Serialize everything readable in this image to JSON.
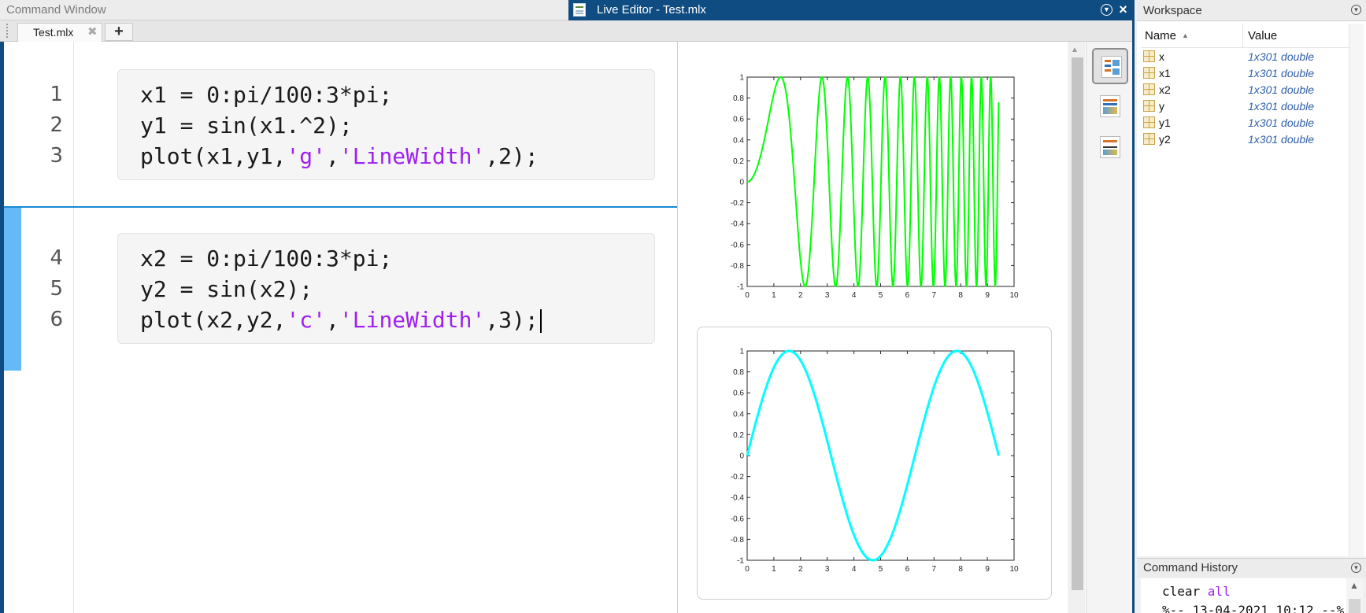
{
  "command_window": {
    "title": "Command Window"
  },
  "live_editor": {
    "title": "Live Editor - Test.mlx",
    "tabs": [
      {
        "label": "Test.mlx",
        "close": "✖"
      }
    ],
    "add_tab": "+"
  },
  "code": {
    "sections": [
      {
        "lines": [
          {
            "num": "1",
            "parts": [
              {
                "t": "x1 = 0:pi/100:3*pi;"
              }
            ]
          },
          {
            "num": "2",
            "parts": [
              {
                "t": "y1 = sin(x1.^2);"
              }
            ]
          },
          {
            "num": "3",
            "parts": [
              {
                "t": "plot(x1,y1,"
              },
              {
                "t": "'g'",
                "s": true
              },
              {
                "t": ","
              },
              {
                "t": "'LineWidth'",
                "s": true
              },
              {
                "t": ",2);"
              }
            ]
          }
        ]
      },
      {
        "lines": [
          {
            "num": "4",
            "parts": [
              {
                "t": "x2 = 0:pi/100:3*pi;"
              }
            ]
          },
          {
            "num": "5",
            "parts": [
              {
                "t": "y2 = sin(x2);"
              }
            ]
          },
          {
            "num": "6",
            "parts": [
              {
                "t": "plot(x2,y2,"
              },
              {
                "t": "'c'",
                "s": true
              },
              {
                "t": ","
              },
              {
                "t": "'LineWidth'",
                "s": true
              },
              {
                "t": ",3);"
              }
            ]
          }
        ]
      }
    ]
  },
  "output_toolbar": {
    "icons": [
      "output-inline-icon",
      "output-right-icon",
      "hide-code-icon"
    ]
  },
  "chart_data": [
    {
      "type": "line",
      "function": "y = sin(x.^2)",
      "x_range": [
        0,
        9.42478
      ],
      "x_step": 0.0314159,
      "xlim": [
        0,
        10
      ],
      "ylim": [
        -1,
        1
      ],
      "xticks": [
        "0",
        "1",
        "2",
        "3",
        "4",
        "5",
        "6",
        "7",
        "8",
        "9",
        "10"
      ],
      "yticks": [
        "1",
        "0.8",
        "0.6",
        "0.4",
        "0.2",
        "0",
        "-0.2",
        "-0.4",
        "-0.6",
        "-0.8",
        "-1"
      ],
      "color": "#00ff00",
      "line_width": 2,
      "grid": false
    },
    {
      "type": "line",
      "function": "y = sin(x)",
      "x_range": [
        0,
        9.42478
      ],
      "x_step": 0.0314159,
      "xlim": [
        0,
        10
      ],
      "ylim": [
        -1,
        1
      ],
      "xticks": [
        "0",
        "1",
        "2",
        "3",
        "4",
        "5",
        "6",
        "7",
        "8",
        "9",
        "10"
      ],
      "yticks": [
        "1",
        "0.8",
        "0.6",
        "0.4",
        "0.2",
        "0",
        "-0.2",
        "-0.4",
        "-0.6",
        "-0.8",
        "-1"
      ],
      "color": "#00ffff",
      "line_width": 3,
      "grid": false
    }
  ],
  "workspace": {
    "title": "Workspace",
    "columns": {
      "name": "Name",
      "value": "Value"
    },
    "rows": [
      {
        "name": "x",
        "value": "1x301 double"
      },
      {
        "name": "x1",
        "value": "1x301 double"
      },
      {
        "name": "x2",
        "value": "1x301 double"
      },
      {
        "name": "y",
        "value": "1x301 double"
      },
      {
        "name": "y1",
        "value": "1x301 double"
      },
      {
        "name": "y2",
        "value": "1x301 double"
      }
    ]
  },
  "command_history": {
    "title": "Command History",
    "lines": [
      {
        "parts": [
          {
            "t": "clear "
          },
          {
            "t": "all",
            "k": true
          }
        ]
      },
      {
        "parts": [
          {
            "t": "%-- 13-04-2021 10:12 --%"
          }
        ]
      }
    ]
  },
  "colors": {
    "accent": "#0f4c81",
    "section_bar": "#65b9f7",
    "string": "#a020f0",
    "workspace_value": "#2f5fa8"
  }
}
